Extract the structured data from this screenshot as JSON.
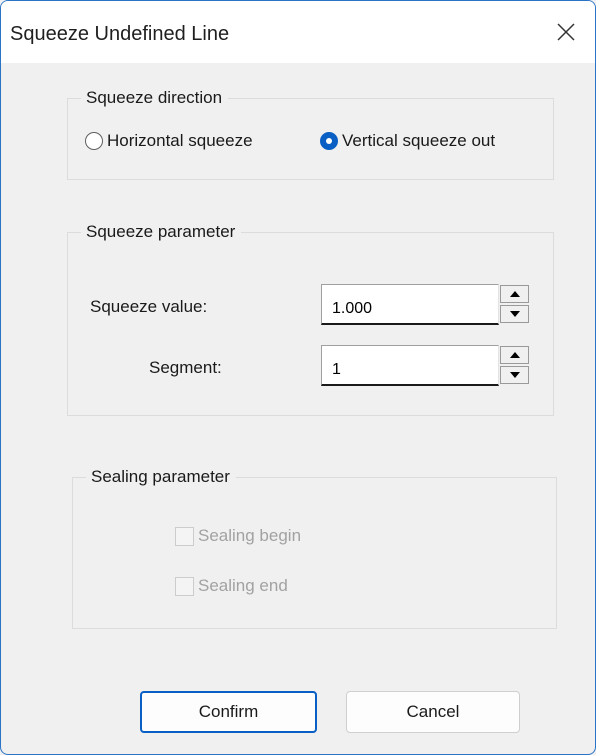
{
  "window": {
    "title": "Squeeze Undefined Line"
  },
  "direction_group": {
    "legend": "Squeeze direction",
    "options": [
      {
        "label": "Horizontal squeeze",
        "checked": false
      },
      {
        "label": "Vertical squeeze out",
        "checked": true
      }
    ]
  },
  "parameter_group": {
    "legend": "Squeeze parameter",
    "squeeze_value_label": "Squeeze value:",
    "squeeze_value": "1.000",
    "segment_label": "Segment:",
    "segment_value": "1"
  },
  "sealing_group": {
    "legend": "Sealing parameter",
    "sealing_begin_label": "Sealing begin",
    "sealing_end_label": "Sealing end"
  },
  "buttons": {
    "confirm": "Confirm",
    "cancel": "Cancel"
  }
}
